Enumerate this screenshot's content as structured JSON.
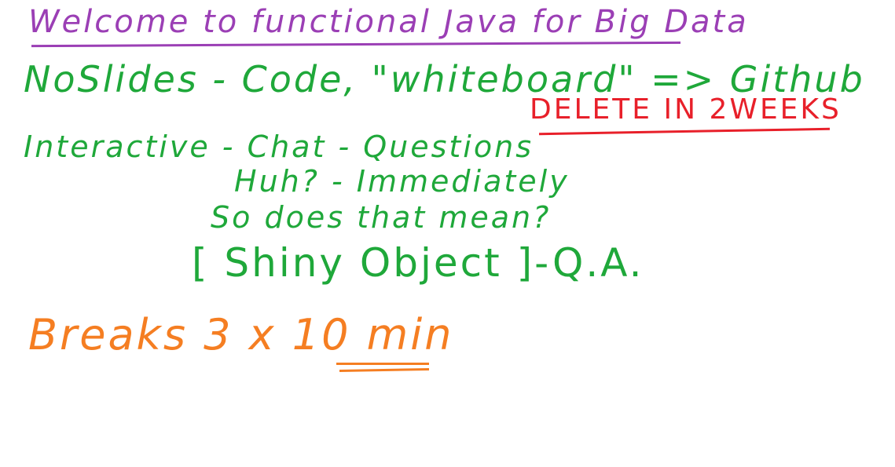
{
  "whiteboard": {
    "title": "Welcome to functional Java for Big Data",
    "lines": {
      "slides": "NoSlides - Code, \"whiteboard\" => Github",
      "delete": "DELETE IN 2WEEKS",
      "interactive": "Interactive - Chat - Questions",
      "huh": "Huh? - Immediately",
      "so_does": "So does that mean?",
      "shiny": "[ Shiny Object ]-Q.A.",
      "breaks": "Breaks   3 x 10 min"
    },
    "colors": {
      "title": "#9b3fb5",
      "body": "#1fa83a",
      "delete": "#e8202a",
      "breaks": "#f57e22",
      "background": "#ffffff"
    }
  }
}
